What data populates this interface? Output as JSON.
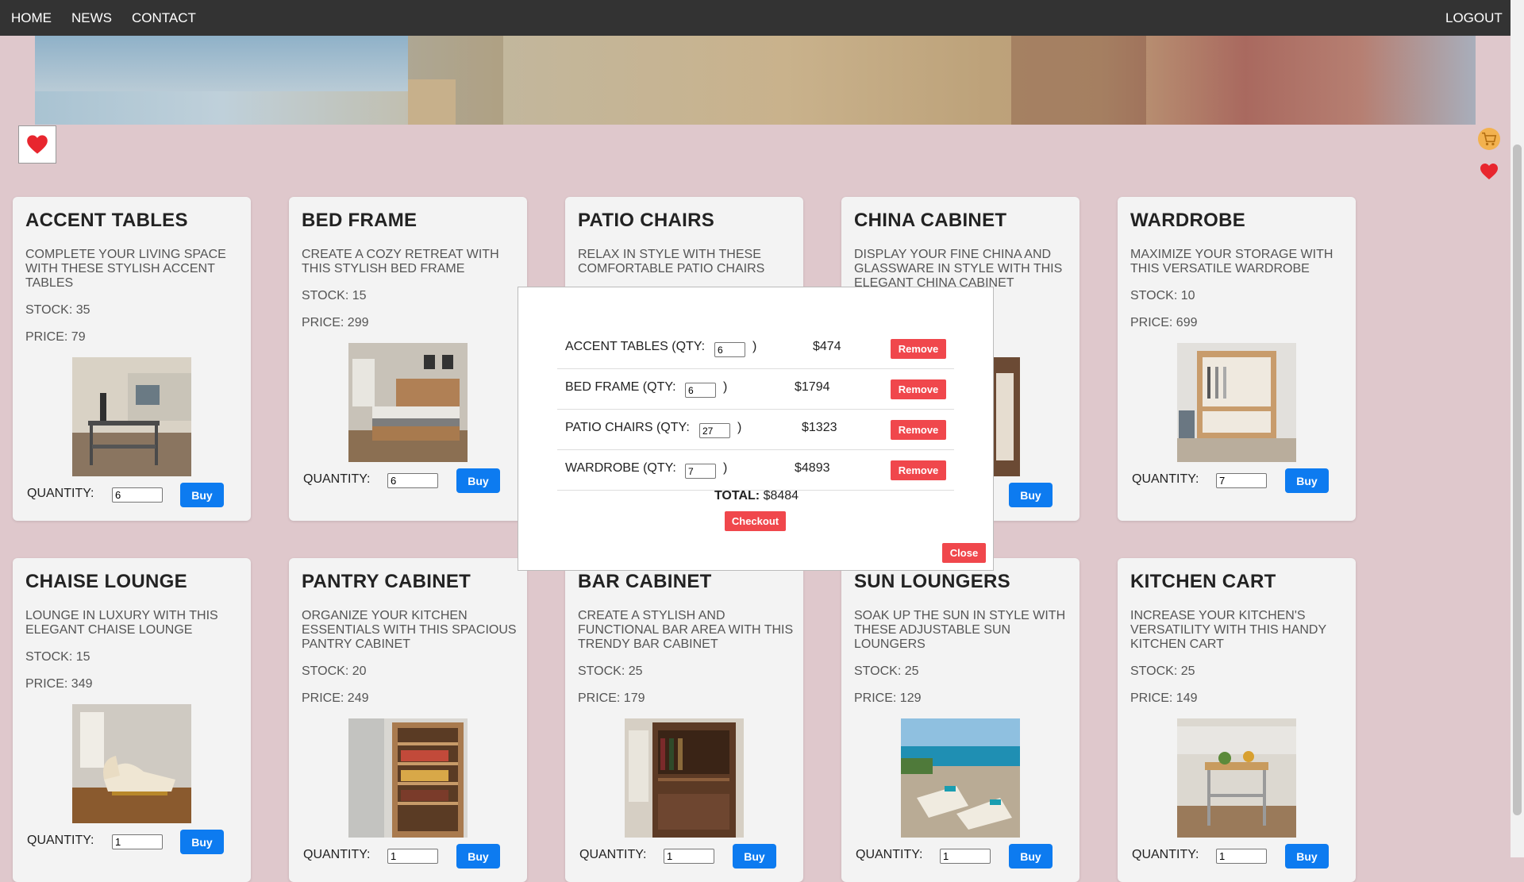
{
  "nav": {
    "home": "HOME",
    "news": "NEWS",
    "contact": "CONTACT",
    "logout": "LOGOUT"
  },
  "icons": {
    "favorites": "heart-icon",
    "cart": "shopping-cart-icon",
    "heart_color": "#e8262e",
    "cart_color": "#f3b24f"
  },
  "products": [
    {
      "name": "ACCENT TABLES",
      "description": "COMPLETE YOUR LIVING SPACE WITH THESE STYLISH ACCENT TABLES",
      "stock": "STOCK: 35",
      "price": "PRICE: 79",
      "quantity_label": "QUANTITY:",
      "quantity": "6",
      "buy": "Buy"
    },
    {
      "name": "BED FRAME",
      "description": "CREATE A COZY RETREAT WITH THIS STYLISH BED FRAME",
      "stock": "STOCK: 15",
      "price": "PRICE: 299",
      "quantity_label": "QUANTITY:",
      "quantity": "6",
      "buy": "Buy"
    },
    {
      "name": "PATIO CHAIRS",
      "description": "RELAX IN STYLE WITH THESE COMFORTABLE PATIO CHAIRS",
      "stock": "",
      "price": "",
      "quantity_label": "",
      "quantity": "",
      "buy": ""
    },
    {
      "name": "CHINA CABINET",
      "description": "DISPLAY YOUR FINE CHINA AND GLASSWARE IN STYLE WITH THIS ELEGANT CHINA CABINET",
      "stock": "",
      "price": "",
      "quantity_label": "",
      "quantity": "",
      "buy": "Buy"
    },
    {
      "name": "WARDROBE",
      "description": "MAXIMIZE YOUR STORAGE WITH THIS VERSATILE WARDROBE",
      "stock": "STOCK: 10",
      "price": "PRICE: 699",
      "quantity_label": "QUANTITY:",
      "quantity": "7",
      "buy": "Buy"
    },
    {
      "name": "CHAISE LOUNGE",
      "description": "LOUNGE IN LUXURY WITH THIS ELEGANT CHAISE LOUNGE",
      "stock": "STOCK: 15",
      "price": "PRICE: 349",
      "quantity_label": "QUANTITY:",
      "quantity": "1",
      "buy": "Buy"
    },
    {
      "name": "PANTRY CABINET",
      "description": "ORGANIZE YOUR KITCHEN ESSENTIALS WITH THIS SPACIOUS PANTRY CABINET",
      "stock": "STOCK: 20",
      "price": "PRICE: 249",
      "quantity_label": "QUANTITY:",
      "quantity": "1",
      "buy": "Buy"
    },
    {
      "name": "BAR CABINET",
      "description": "CREATE A STYLISH AND FUNCTIONAL BAR AREA WITH THIS TRENDY BAR CABINET",
      "stock": "STOCK: 25",
      "price": "PRICE: 179",
      "quantity_label": "QUANTITY:",
      "quantity": "1",
      "buy": "Buy"
    },
    {
      "name": "SUN LOUNGERS",
      "description": "SOAK UP THE SUN IN STYLE WITH THESE ADJUSTABLE SUN LOUNGERS",
      "stock": "STOCK: 25",
      "price": "PRICE: 129",
      "quantity_label": "QUANTITY:",
      "quantity": "1",
      "buy": "Buy"
    },
    {
      "name": "KITCHEN CART",
      "description": "INCREASE YOUR KITCHEN'S VERSATILITY WITH THIS HANDY KITCHEN CART",
      "stock": "STOCK: 25",
      "price": "PRICE: 149",
      "quantity_label": "QUANTITY:",
      "quantity": "1",
      "buy": "Buy"
    }
  ],
  "cart": {
    "items": [
      {
        "label": "ACCENT TABLES (QTY:",
        "qty": "6",
        "close": ")",
        "price": "$474",
        "remove": "Remove"
      },
      {
        "label": "BED FRAME (QTY:",
        "qty": "6",
        "close": ")",
        "price": "$1794",
        "remove": "Remove"
      },
      {
        "label": "PATIO CHAIRS (QTY:",
        "qty": "27",
        "close": ")",
        "price": "$1323",
        "remove": "Remove"
      },
      {
        "label": "WARDROBE (QTY:",
        "qty": "7",
        "close": ")",
        "price": "$4893",
        "remove": "Remove"
      }
    ],
    "total_label": "TOTAL:",
    "total_value": "$8484",
    "checkout": "Checkout",
    "close": "Close"
  }
}
